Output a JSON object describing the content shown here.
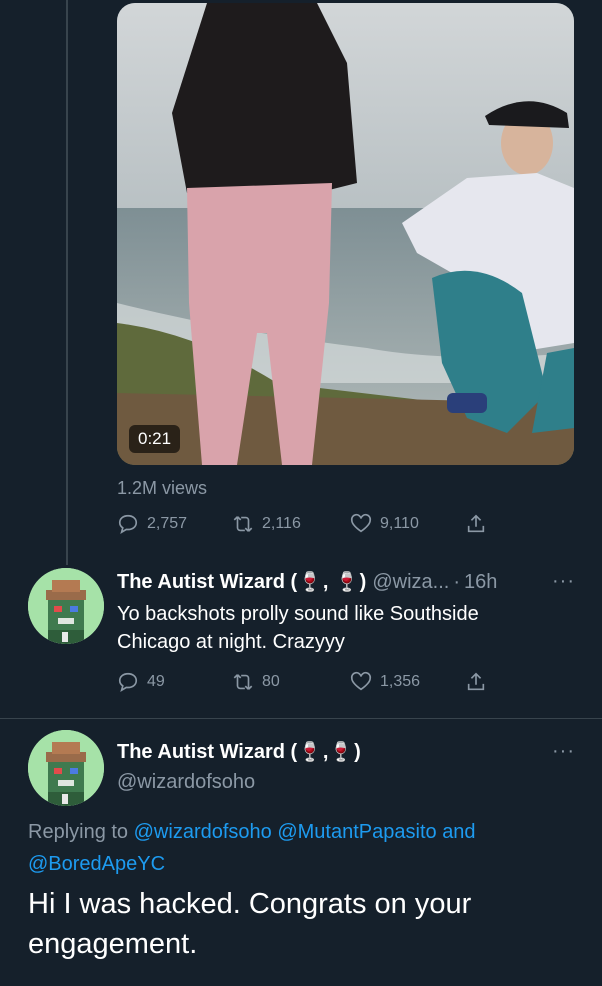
{
  "video": {
    "duration": "0:21",
    "views": "1.2M views"
  },
  "tweet1_actions": {
    "replies": "2,757",
    "retweets": "2,116",
    "likes": "9,110"
  },
  "reply1": {
    "name_prefix": "The Autist Wizard (",
    "name_sep": ",",
    "name_suffix": ")",
    "wine_glyph": "🍷",
    "handle": "@wiza...",
    "separator": "·",
    "time": "16h",
    "text": "Yo backshots prolly sound like Southside Chicago at night. Crazyyy",
    "replies": "49",
    "retweets": "80",
    "likes": "1,356"
  },
  "reply2": {
    "name_prefix": "The Autist Wizard (",
    "name_sep": ",",
    "name_suffix": ")",
    "handle": "@wizardofsoho",
    "replying_label": "Replying to",
    "mention1": "@wizardofsoho",
    "mention2": "@MutantPapasito",
    "and_word": "and",
    "mention3": "@BoredApeYC",
    "text": "Hi I was hacked. Congrats on your engagement."
  },
  "more_label": "···",
  "colors": {
    "background": "#15202b",
    "muted": "#8b98a5",
    "link": "#1d9bf0",
    "line": "#38444d"
  }
}
